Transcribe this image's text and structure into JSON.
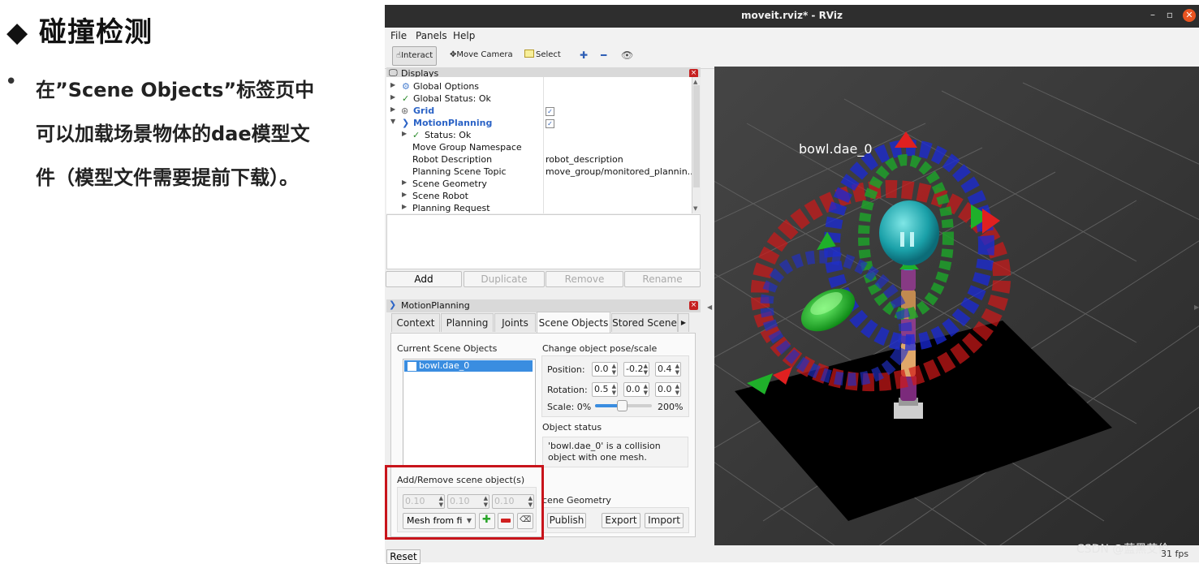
{
  "slide": {
    "title": "◆ 碰撞检测",
    "bullet_line1": "在”Scene Objects”标签页中",
    "bullet_line2": "可以加载场景物体的dae模型文",
    "bullet_line3": "件（模型文件需要提前下载）。"
  },
  "window": {
    "title": "moveit.rviz* - RViz",
    "controls": {
      "minimize": "–",
      "maximize": "▫",
      "close": "✕"
    }
  },
  "menu": [
    "File",
    "Panels",
    "Help"
  ],
  "toolbar": {
    "interact": "Interact",
    "move_camera": "Move Camera",
    "select": "Select"
  },
  "displays": {
    "header": "Displays",
    "rows": [
      {
        "name": "Global Options",
        "value": ""
      },
      {
        "name": "Global Status: Ok",
        "value": ""
      },
      {
        "name": "Grid",
        "value": ""
      },
      {
        "name": "MotionPlanning",
        "value": ""
      },
      {
        "name": "Status: Ok",
        "value": ""
      },
      {
        "name": "Move Group Namespace",
        "value": ""
      },
      {
        "name": "Robot Description",
        "value": "robot_description"
      },
      {
        "name": "Planning Scene Topic",
        "value": "move_group/monitored_plannin..."
      },
      {
        "name": "Scene Geometry",
        "value": ""
      },
      {
        "name": "Scene Robot",
        "value": ""
      },
      {
        "name": "Planning Request",
        "value": ""
      }
    ],
    "buttons": {
      "add": "Add",
      "duplicate": "Duplicate",
      "remove": "Remove",
      "rename": "Rename"
    }
  },
  "motion_planning": {
    "header": "MotionPlanning",
    "tabs": [
      "Context",
      "Planning",
      "Joints",
      "Scene Objects",
      "Stored Scene"
    ],
    "selected_tab": "Scene Objects",
    "current_objects_label": "Current Scene Objects",
    "objects": [
      "bowl.dae_0"
    ],
    "pose_label": "Change object pose/scale",
    "position_label": "Position:",
    "position": [
      "0.0",
      "-0.2",
      "0.4"
    ],
    "rotation_label": "Rotation:",
    "rotation": [
      "0.5",
      "0.0",
      "0.0"
    ],
    "scale_label": "Scale: 0%",
    "scale_max": "200%",
    "scale_fraction": 0.45,
    "status_label": "Object status",
    "status_line1": "'bowl.dae_0' is a collision",
    "status_line2": "object with one mesh.",
    "add_remove_label": "Add/Remove scene object(s)",
    "size_values": [
      "0.10",
      "0.10",
      "0.10"
    ],
    "shape_option": "Mesh from fi",
    "scene_geometry_label": "cene Geometry",
    "publish": "Publish",
    "export": "Export",
    "import": "Import",
    "reset": "Reset"
  },
  "viewport": {
    "label": "bowl.dae_0",
    "fps": "31 fps",
    "watermark": "CSDN @蓝黑艾伦"
  },
  "colors": {
    "highlight_border": "#c8141b",
    "selection": "#3a8de0",
    "viewport_bg": "#333333",
    "ring_red": "#e02020",
    "ring_green": "#20c030",
    "ring_blue": "#2030d8"
  }
}
